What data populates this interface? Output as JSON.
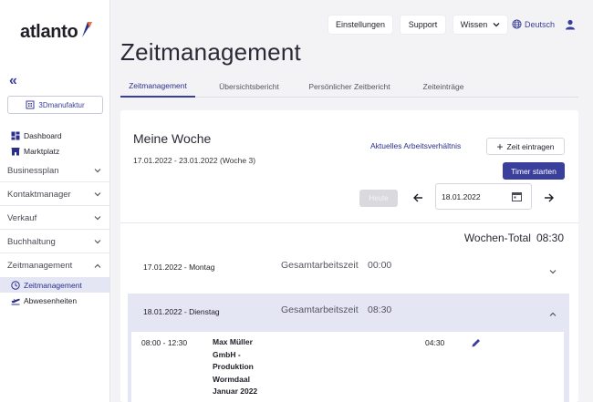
{
  "app": {
    "logo_text": "atlanto",
    "accent": "#3a3f9c"
  },
  "sidebar": {
    "collapse_icon": "double-chevron-left-icon",
    "company": "3Dmanufaktur",
    "links": [
      {
        "label": "Dashboard",
        "icon": "dashboard-icon"
      },
      {
        "label": "Marktplatz",
        "icon": "store-icon"
      }
    ],
    "groups": [
      {
        "label": "Businessplan",
        "expanded": false
      },
      {
        "label": "Kontaktmanager",
        "expanded": false
      },
      {
        "label": "Verkauf",
        "expanded": false
      },
      {
        "label": "Buchhaltung",
        "expanded": false
      },
      {
        "label": "Zeitmanagement",
        "expanded": true
      }
    ],
    "subitems": [
      {
        "label": "Zeitmanagement",
        "active": true,
        "icon": "clock-icon"
      },
      {
        "label": "Abwesenheiten",
        "active": false,
        "icon": "plane-icon"
      }
    ]
  },
  "topbar": {
    "settings": "Einstellungen",
    "support": "Support",
    "wissen": "Wissen",
    "language": "Deutsch"
  },
  "page": {
    "title": "Zeitmanagement",
    "tabs": [
      {
        "label": "Zeitmanagement",
        "active": true
      },
      {
        "label": "Übersichtsbericht",
        "active": false
      },
      {
        "label": "Persönlicher Zeitbericht",
        "active": false
      },
      {
        "label": "Zeiteinträge",
        "active": false
      }
    ]
  },
  "week": {
    "title": "Meine Woche",
    "range": "17.01.2022 - 23.01.2022 (Woche 3)",
    "employment_link": "Aktuelles Arbeitsverhältnis",
    "add_time": "Zeit eintragen",
    "start_timer": "Timer starten",
    "today": "Heute",
    "date_value": "18.01.2022",
    "total_label": "Wochen-Total",
    "total_value": "08:30"
  },
  "days": [
    {
      "date": "17.01.2022 - Montag",
      "label": "Gesamtarbeitszeit",
      "value": "00:00",
      "expanded": false
    },
    {
      "date": "18.01.2022 - Dienstag",
      "label": "Gesamtarbeitszeit",
      "value": "08:30",
      "expanded": true
    }
  ],
  "entries": [
    {
      "time": "08:00 - 12:30",
      "description_lines": [
        "Max Müller",
        "GmbH -",
        "Produktion",
        "Wormdaal",
        "Januar 2022"
      ],
      "duration": "04:30"
    }
  ]
}
